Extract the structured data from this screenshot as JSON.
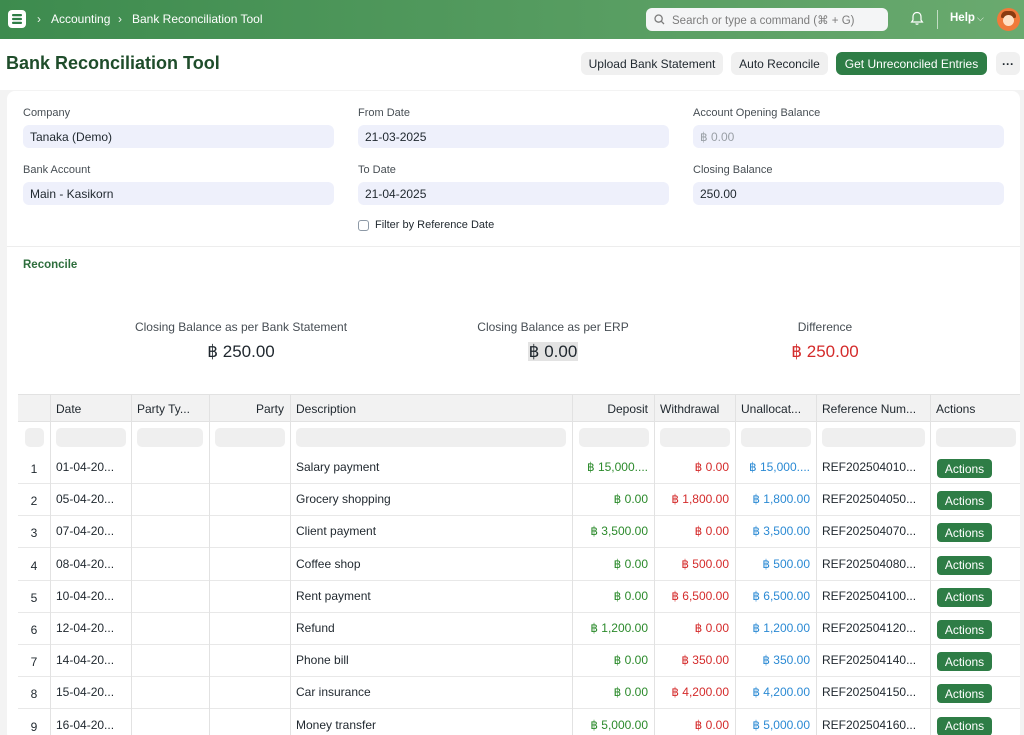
{
  "nav": {
    "breadcrumbs": [
      "Accounting",
      "Bank Reconciliation Tool"
    ],
    "search_placeholder": "Search or type a command (⌘ + G)",
    "help_label": "Help"
  },
  "page": {
    "title": "Bank Reconciliation Tool",
    "buttons": {
      "upload": "Upload Bank Statement",
      "auto": "Auto Reconcile",
      "get": "Get Unreconciled Entries",
      "more": "···"
    }
  },
  "form": {
    "company_label": "Company",
    "company_value": "Tanaka (Demo)",
    "bank_account_label": "Bank Account",
    "bank_account_value": "Main - Kasikorn",
    "from_date_label": "From Date",
    "from_date_value": "21-03-2025",
    "to_date_label": "To Date",
    "to_date_value": "21-04-2025",
    "opening_label": "Account Opening Balance",
    "opening_placeholder": "฿ 0.00",
    "closing_label": "Closing Balance",
    "closing_value": "250.00",
    "filter_ref_label": "Filter by Reference Date"
  },
  "reconcile": {
    "title": "Reconcile",
    "bank_label": "Closing Balance as per Bank Statement",
    "bank_value": "฿ 250.00",
    "erp_label": "Closing Balance as per ERP",
    "erp_value": "฿ 0.00",
    "diff_label": "Difference",
    "diff_value": "฿ 250.00"
  },
  "table": {
    "headers": [
      "Date",
      "Party Ty...",
      "Party",
      "Description",
      "Deposit",
      "Withdrawal",
      "Unallocat...",
      "Reference Num...",
      "Actions"
    ],
    "action_label": "Actions",
    "rows": [
      {
        "no": "1",
        "date": "01-04-20...",
        "desc": "Salary payment",
        "deposit": "฿ 15,000....",
        "withdrawal": "฿ 0.00",
        "unalloc": "฿ 15,000....",
        "ref": "REF202504010..."
      },
      {
        "no": "2",
        "date": "05-04-20...",
        "desc": "Grocery shopping",
        "deposit": "฿ 0.00",
        "withdrawal": "฿ 1,800.00",
        "unalloc": "฿ 1,800.00",
        "ref": "REF202504050..."
      },
      {
        "no": "3",
        "date": "07-04-20...",
        "desc": "Client payment",
        "deposit": "฿ 3,500.00",
        "withdrawal": "฿ 0.00",
        "unalloc": "฿ 3,500.00",
        "ref": "REF202504070..."
      },
      {
        "no": "4",
        "date": "08-04-20...",
        "desc": "Coffee shop",
        "deposit": "฿ 0.00",
        "withdrawal": "฿ 500.00",
        "unalloc": "฿ 500.00",
        "ref": "REF202504080..."
      },
      {
        "no": "5",
        "date": "10-04-20...",
        "desc": "Rent payment",
        "deposit": "฿ 0.00",
        "withdrawal": "฿ 6,500.00",
        "unalloc": "฿ 6,500.00",
        "ref": "REF202504100..."
      },
      {
        "no": "6",
        "date": "12-04-20...",
        "desc": "Refund",
        "deposit": "฿ 1,200.00",
        "withdrawal": "฿ 0.00",
        "unalloc": "฿ 1,200.00",
        "ref": "REF202504120..."
      },
      {
        "no": "7",
        "date": "14-04-20...",
        "desc": "Phone bill",
        "deposit": "฿ 0.00",
        "withdrawal": "฿ 350.00",
        "unalloc": "฿ 350.00",
        "ref": "REF202504140..."
      },
      {
        "no": "8",
        "date": "15-04-20...",
        "desc": "Car insurance",
        "deposit": "฿ 0.00",
        "withdrawal": "฿ 4,200.00",
        "unalloc": "฿ 4,200.00",
        "ref": "REF202504150..."
      },
      {
        "no": "9",
        "date": "16-04-20...",
        "desc": "Money transfer",
        "deposit": "฿ 5,000.00",
        "withdrawal": "฿ 0.00",
        "unalloc": "฿ 5,000.00",
        "ref": "REF202504160..."
      }
    ]
  }
}
